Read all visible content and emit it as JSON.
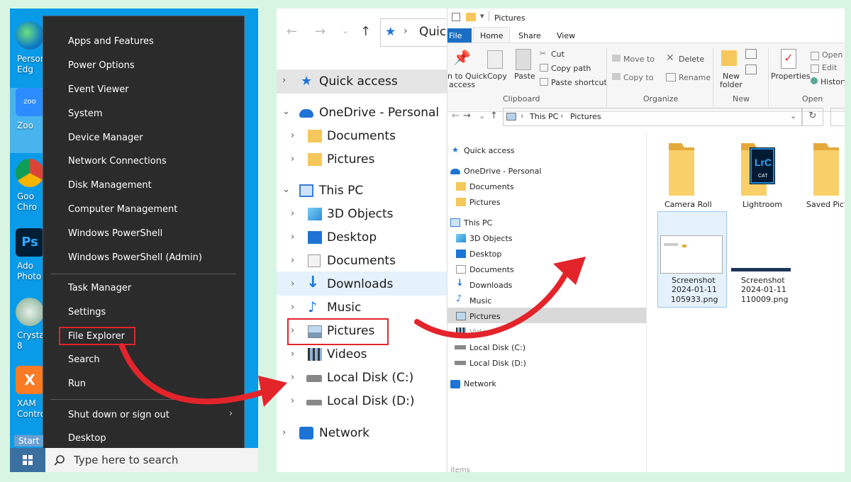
{
  "desktop_icons": [
    {
      "label1": "Person",
      "label2": "Edg",
      "icon": "edge-icon"
    },
    {
      "label1": "Zoo",
      "label2": "",
      "icon": "zoom-icon"
    },
    {
      "label1": "Goo",
      "label2": "Chro",
      "icon": "chrome-icon"
    },
    {
      "label1": "Ado",
      "label2": "Photo",
      "icon": "photoshop-icon"
    },
    {
      "label1": "CrystalD",
      "label2": "8",
      "icon": "crystaldisk-icon"
    },
    {
      "label1": "XAM",
      "label2": "Control",
      "icon": "xampp-icon"
    }
  ],
  "winx_menu": {
    "items": [
      "Apps and Features",
      "Power Options",
      "Event Viewer",
      "System",
      "Device Manager",
      "Network Connections",
      "Disk Management",
      "Computer Management",
      "Windows PowerShell",
      "Windows PowerShell (Admin)",
      "Task Manager",
      "Settings",
      "File Explorer",
      "Search",
      "Run",
      "Shut down or sign out",
      "Desktop"
    ],
    "highlighted": "File Explorer"
  },
  "taskbar": {
    "start_label": "Start",
    "search_placeholder": "Type here to search"
  },
  "nav_zoom": {
    "address_partial": "Quick",
    "items": [
      "Quick access",
      "OneDrive - Personal",
      "Documents",
      "Pictures",
      "This PC",
      "3D Objects",
      "Desktop",
      "Documents",
      "Downloads",
      "Music",
      "Pictures",
      "Videos",
      "Local Disk (C:)",
      "Local Disk (D:)",
      "Network"
    ]
  },
  "explorer": {
    "title": "Pictures",
    "tabs": [
      "File",
      "Home",
      "Share",
      "View"
    ],
    "ribbon": {
      "pin": "n to Quick",
      "pin2": "access",
      "copy": "Copy",
      "paste": "Paste",
      "cut": "Cut",
      "copy_path": "Copy path",
      "paste_shortcut": "Paste shortcut",
      "clipboard": "Clipboard",
      "move_to": "Move to",
      "copy_to": "Copy to",
      "delete": "Delete",
      "rename": "Rename",
      "organize": "Organize",
      "new_folder1": "New",
      "new_folder2": "folder",
      "new_group": "New",
      "properties": "Properties",
      "open": "Open",
      "edit": "Edit",
      "history": "History",
      "open_group": "Open"
    },
    "breadcrumb": [
      "This PC",
      "Pictures"
    ],
    "nav": [
      "Quick access",
      "OneDrive - Personal",
      "Documents",
      "Pictures",
      "This PC",
      "3D Objects",
      "Desktop",
      "Documents",
      "Downloads",
      "Music",
      "Pictures",
      "Videos",
      "Local Disk (C:)",
      "Local Disk (D:)",
      "Network"
    ],
    "files": [
      {
        "name": "Camera Roll"
      },
      {
        "name": "Lightroom"
      },
      {
        "name": "Saved Pictu"
      },
      {
        "name1": "Screenshot",
        "name2": "2024-01-11",
        "name3": "105933.png"
      },
      {
        "name1": "Screenshot",
        "name2": "2024-01-11",
        "name3": "110009.png"
      }
    ],
    "status": "items"
  },
  "colors": {
    "accent": "#0078d4",
    "highlight": "#e3242b",
    "folder": "#f6c75a"
  }
}
